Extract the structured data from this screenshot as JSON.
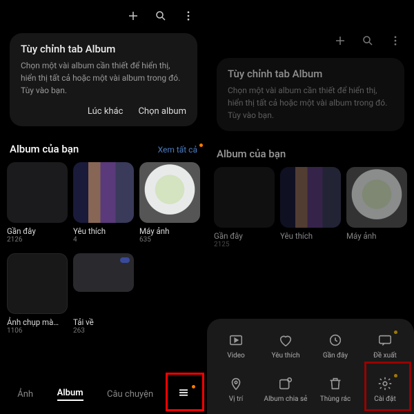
{
  "left": {
    "card": {
      "title": "Tùy chỉnh tab Album",
      "body": "Chọn một vài album cần thiết để hiển thị, hiển thị tất cả hoặc một vài album trong đó. Tùy vào bạn.",
      "later": "Lúc khác",
      "choose": "Chọn album"
    },
    "section_title": "Album của bạn",
    "see_all": "Xem tất cả",
    "albums": [
      {
        "name": "Gần đây",
        "count": "2126"
      },
      {
        "name": "Yêu thích",
        "count": "4"
      },
      {
        "name": "Máy ảnh",
        "count": "635"
      }
    ],
    "albums2": [
      {
        "name": "Ảnh chụp mà…",
        "count": "1106"
      },
      {
        "name": "Tải về",
        "count": "263"
      }
    ],
    "tabs": [
      "Ảnh",
      "Album",
      "Câu chuyện"
    ]
  },
  "right": {
    "card": {
      "title": "Tùy chỉnh tab Album",
      "body": "Chọn một vài album cần thiết để hiển thị, hiển thị tất cả hoặc một vài album trong đó. Tùy vào bạn."
    },
    "section_title": "Album của bạn",
    "albums": [
      {
        "name": "Gần đây",
        "count": "2125"
      },
      {
        "name": "Yêu thích",
        "count": ""
      },
      {
        "name": "Máy ảnh",
        "count": ""
      }
    ],
    "menu": [
      {
        "label": "Video"
      },
      {
        "label": "Yêu thích"
      },
      {
        "label": "Gần đây"
      },
      {
        "label": "Đề xuất"
      },
      {
        "label": "Vị trí"
      },
      {
        "label": "Album chia sẻ"
      },
      {
        "label": "Thùng rác"
      },
      {
        "label": "Cài đặt"
      }
    ]
  }
}
